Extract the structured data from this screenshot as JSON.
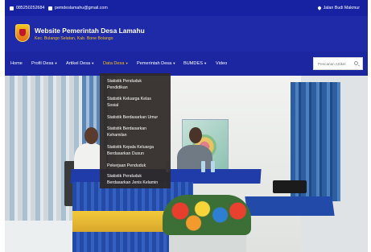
{
  "topbar": {
    "phone": "085250252684",
    "email": "pemdeslamahu@gmail.com",
    "location": "Jalan Budi Makmur"
  },
  "header": {
    "title": "Website Pemerintah Desa Lamahu",
    "subtitle": "Kec. Bulango Selatan, Kab. Bone Bolango"
  },
  "nav": {
    "items": [
      {
        "label": "Home",
        "caret": ""
      },
      {
        "label": "Profil Desa",
        "caret": "▾"
      },
      {
        "label": "Artikel Desa",
        "caret": "▾"
      },
      {
        "label": "Data Desa",
        "caret": "▾"
      },
      {
        "label": "Pemerintah Desa",
        "caret": "▾"
      },
      {
        "label": "BUMDES",
        "caret": "▾"
      },
      {
        "label": "Video",
        "caret": ""
      }
    ],
    "search_placeholder": "Pencarian Artikel"
  },
  "dropdown": {
    "items": [
      {
        "line1": "Statistik Penduduk",
        "line2": "Pendidikan"
      },
      {
        "line1": "Statistik Keluarga Kelas",
        "line2": "Sosial"
      },
      {
        "line1": "Statistik Berdasarkan Umur",
        "line2": ""
      },
      {
        "line1": "Statistik Berdasarkan",
        "line2": "Kehamilan"
      },
      {
        "line1": "Statistik Kepala Keluarga",
        "line2": "Berdasarkan Dusun"
      },
      {
        "line1": "Pekerjaan Penduduk",
        "line2": ""
      },
      {
        "line1": "Statistik Penduduk",
        "line2": "Berdasarkan Jenis Kelamin"
      }
    ]
  },
  "colors": {
    "primary": "#1e2aa8",
    "accent": "#f6c21a"
  }
}
